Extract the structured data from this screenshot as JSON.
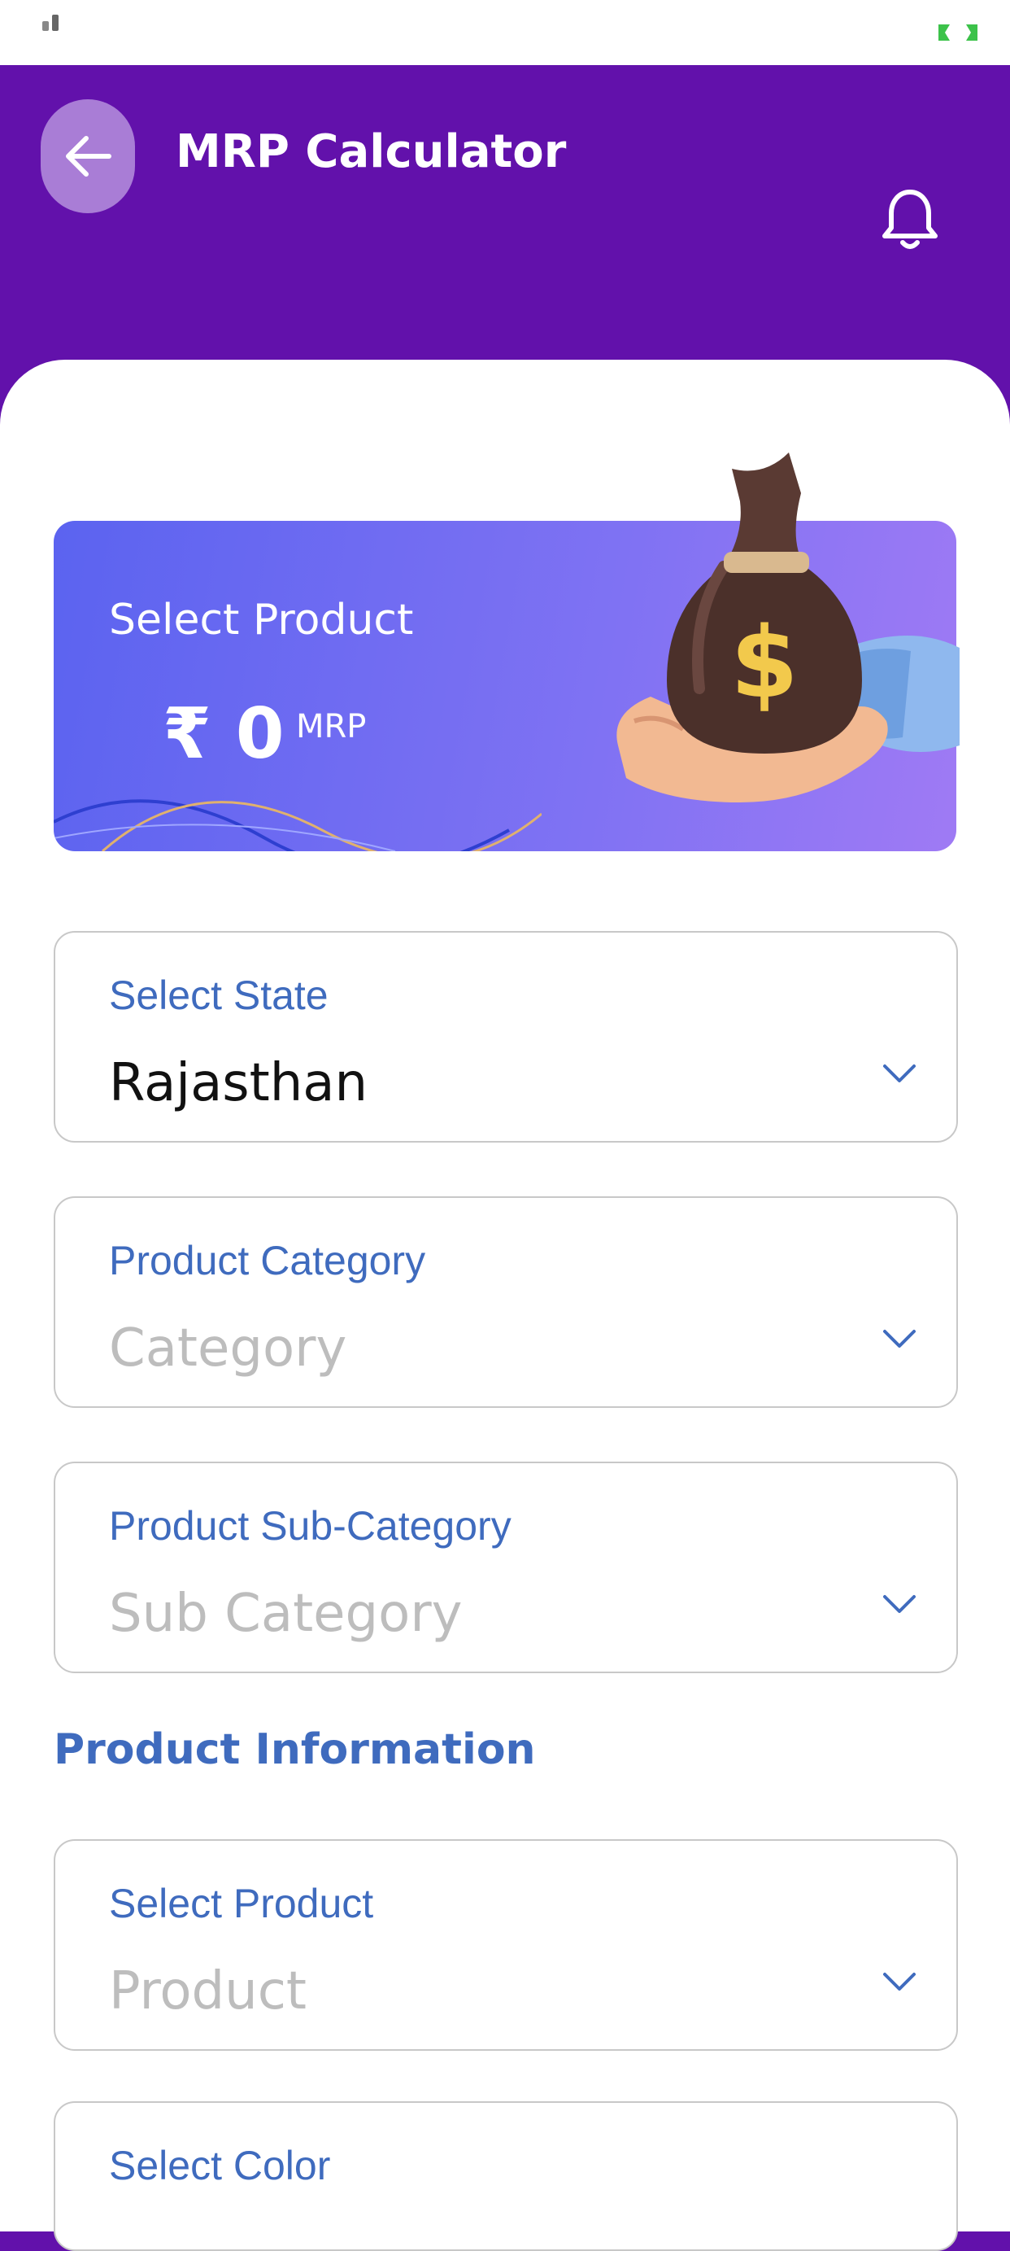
{
  "header": {
    "title": "MRP Calculator"
  },
  "banner": {
    "title": "Select Product",
    "amount": "₹ 0",
    "unit": "MRP"
  },
  "form": {
    "state": {
      "label": "Select State",
      "value": "Rajasthan"
    },
    "category": {
      "label": "Product Category",
      "placeholder": "Category"
    },
    "sub_category": {
      "label": "Product Sub-Category",
      "placeholder": "Sub Category"
    }
  },
  "product_info": {
    "heading": "Product Information",
    "product": {
      "label": "Select Product",
      "placeholder": "Product"
    },
    "color": {
      "label": "Select Color"
    }
  },
  "icons": {
    "back": "arrow-left-icon",
    "notifications": "bell-icon",
    "dropdown": "chevron-down-icon",
    "illustration": "money-bag-hand-icon"
  },
  "colors": {
    "header_bg": "#6211AB",
    "back_button_bg": "#A97DD6",
    "label_blue": "#3F6BBE",
    "placeholder_gray": "#BDBDBD",
    "banner_start": "#5B63F0",
    "banner_end": "#9F7AF4"
  }
}
